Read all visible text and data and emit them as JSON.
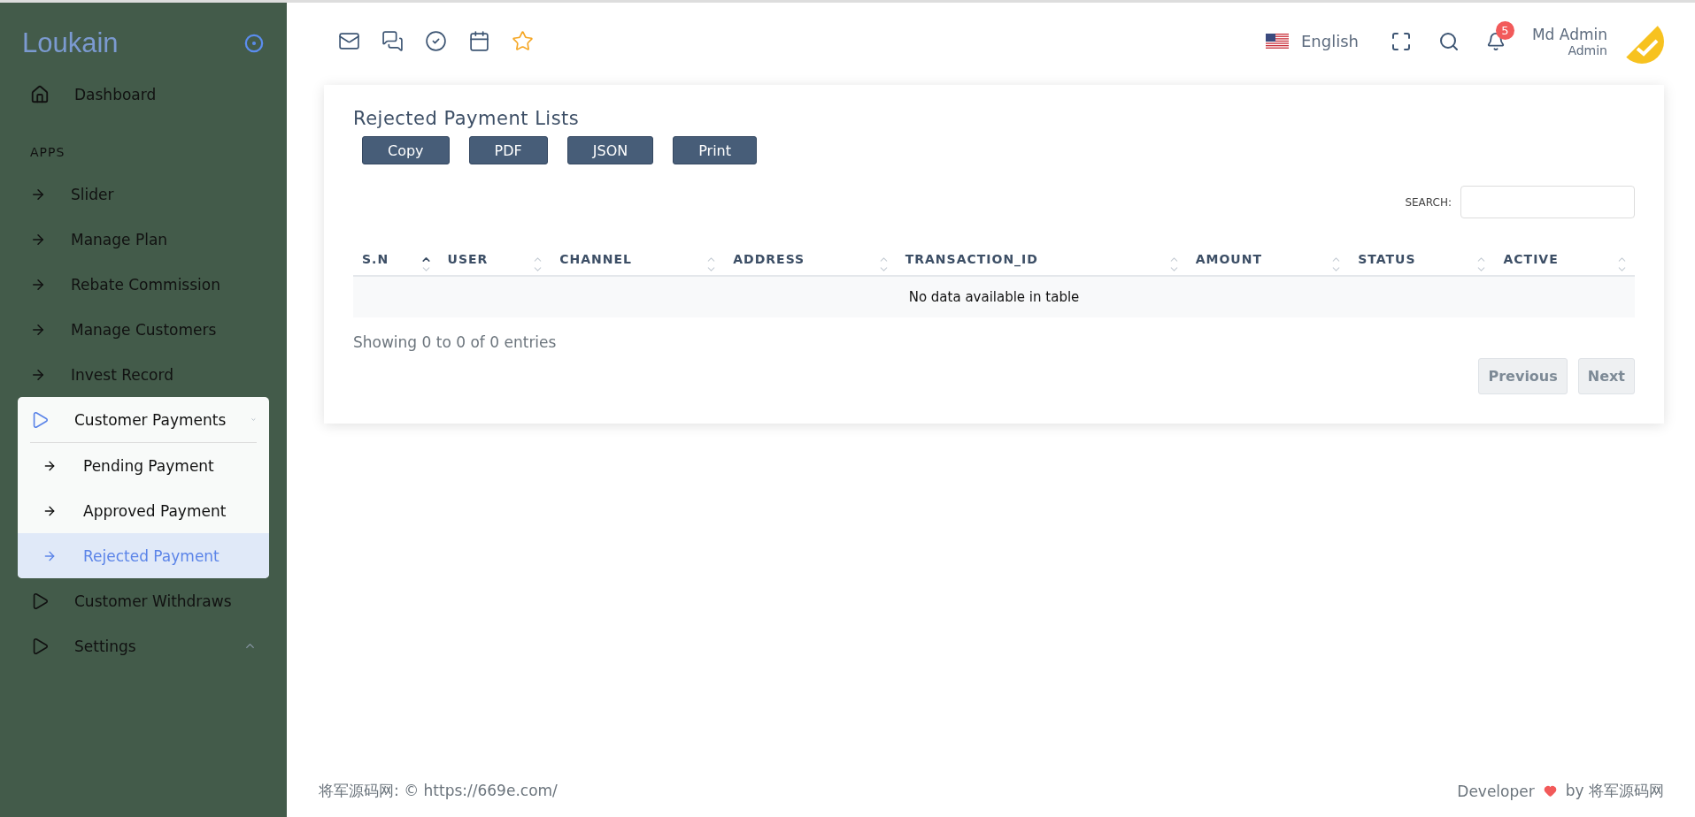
{
  "sidebar": {
    "logo": "Loukain",
    "items": [
      {
        "kind": "home",
        "label": "Dashboard",
        "selected": false
      },
      {
        "kind": "section",
        "label": "APPS"
      },
      {
        "kind": "link",
        "label": "Slider",
        "selected": false
      },
      {
        "kind": "link",
        "label": "Manage Plan",
        "selected": false
      },
      {
        "kind": "link",
        "label": "Rebate Commission",
        "selected": false
      },
      {
        "kind": "link",
        "label": "Manage Customers",
        "selected": false
      },
      {
        "kind": "link",
        "label": "Invest Record",
        "selected": false
      },
      {
        "kind": "group",
        "label": "Customer Payments",
        "expanded": true,
        "children": [
          {
            "label": "Pending Payment",
            "selected": false
          },
          {
            "label": "Approved Payment",
            "selected": false
          },
          {
            "label": "Rejected Payment",
            "selected": true
          }
        ]
      },
      {
        "kind": "group",
        "label": "Customer Withdraws",
        "expanded": false
      },
      {
        "kind": "group",
        "label": "Settings",
        "expanded": false
      }
    ]
  },
  "topbar": {
    "language": "English",
    "notifications": "5",
    "user": {
      "name": "Md Admin",
      "role": "Admin"
    }
  },
  "card": {
    "title": "Rejected Payment Lists",
    "buttons": [
      "Copy",
      "PDF",
      "JSON",
      "Print"
    ],
    "search": {
      "label": "SEARCH:"
    },
    "table": {
      "columns": [
        {
          "label": "S.N",
          "sorted": true
        },
        {
          "label": "USER",
          "sorted": false
        },
        {
          "label": "CHANNEL",
          "sorted": false
        },
        {
          "label": "ADDRESS",
          "sorted": false
        },
        {
          "label": "TRANSACTION_ID",
          "sorted": false
        },
        {
          "label": "AMOUNT",
          "sorted": false
        },
        {
          "label": "STATUS",
          "sorted": false
        },
        {
          "label": "ACTIVE",
          "sorted": false
        }
      ],
      "empty": "No data available in table"
    },
    "info": "Showing 0 to 0 of 0 entries",
    "pagination": [
      {
        "label": "Previous",
        "disabled": true
      },
      {
        "label": "Next",
        "disabled": true
      }
    ]
  },
  "footer": {
    "left": "将军源码网: © https://669e.com/",
    "right_prefix": "Developer",
    "right_suffix": "by 将军源码网"
  }
}
